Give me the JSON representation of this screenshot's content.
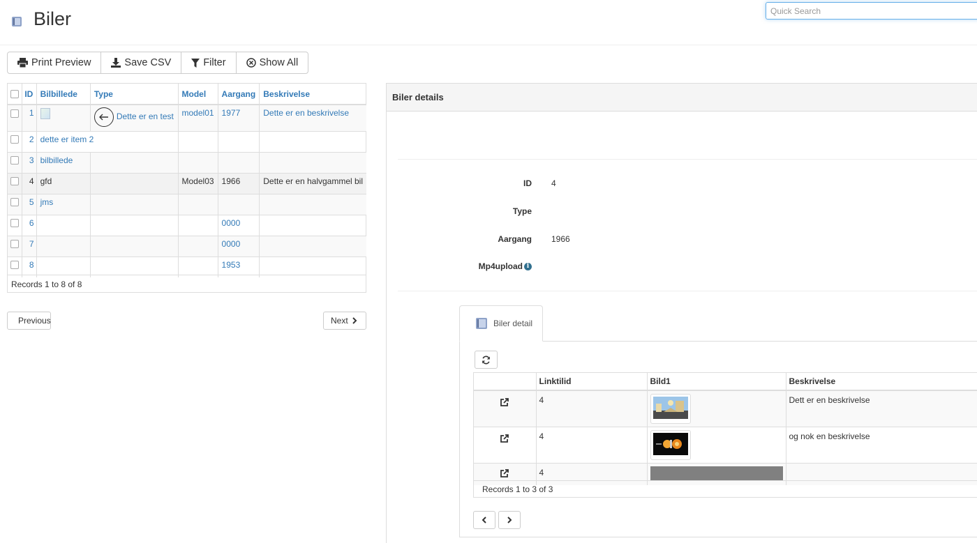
{
  "header": {
    "title": "Biler",
    "search_placeholder": "Quick Search"
  },
  "toolbar": {
    "print_label": "Print Preview",
    "csv_label": "Save CSV",
    "filter_label": "Filter",
    "show_all_label": "Show All"
  },
  "list": {
    "columns": [
      "ID",
      "Bilbillede",
      "Type",
      "Model",
      "Aargang",
      "Beskrivelse"
    ],
    "rows": [
      {
        "id": "1",
        "bilbillede": "",
        "type": "Dette er en test",
        "model": "model01",
        "aargang": "1977",
        "beskrivelse": "Dette er en beskrivelse"
      },
      {
        "id": "2",
        "bilbillede": "dette er item 2",
        "type": "",
        "model": "",
        "aargang": "",
        "beskrivelse": ""
      },
      {
        "id": "3",
        "bilbillede": "bilbillede",
        "type": "",
        "model": "",
        "aargang": "",
        "beskrivelse": ""
      },
      {
        "id": "4",
        "bilbillede": "gfd",
        "type": "",
        "model": "Model03",
        "aargang": "1966",
        "beskrivelse": "Dette er en halvgammel bil"
      },
      {
        "id": "5",
        "bilbillede": "jms",
        "type": "",
        "model": "",
        "aargang": "",
        "beskrivelse": ""
      },
      {
        "id": "6",
        "bilbillede": "",
        "type": "",
        "model": "",
        "aargang": "0000",
        "beskrivelse": ""
      },
      {
        "id": "7",
        "bilbillede": "",
        "type": "",
        "model": "",
        "aargang": "0000",
        "beskrivelse": ""
      },
      {
        "id": "8",
        "bilbillede": "",
        "type": "",
        "model": "",
        "aargang": "1953",
        "beskrivelse": ""
      }
    ],
    "footer": "Records 1 to 8 of 8",
    "prev_label": "Previous",
    "next_label": "Next"
  },
  "details": {
    "title": "Biler details",
    "fields": {
      "id_label": "ID",
      "id_value": "4",
      "type_label": "Type",
      "type_value": "",
      "aargang_label": "Aargang",
      "aargang_value": "1966",
      "mp4_label": "Mp4upload"
    },
    "tab_label": "Biler detail",
    "sub": {
      "columns": [
        "",
        "Linktilid",
        "Bild1",
        "Beskrivelse"
      ],
      "rows": [
        {
          "linktilid": "4",
          "beskrivelse": "Dett er en beskrivelse"
        },
        {
          "linktilid": "4",
          "beskrivelse": "og nok en beskrivelse"
        },
        {
          "linktilid": "4",
          "beskrivelse": ""
        }
      ],
      "footer": "Records 1 to 3 of 3"
    }
  },
  "colors": {
    "link": "#337ab7",
    "accent_focus": "#66afe9"
  }
}
